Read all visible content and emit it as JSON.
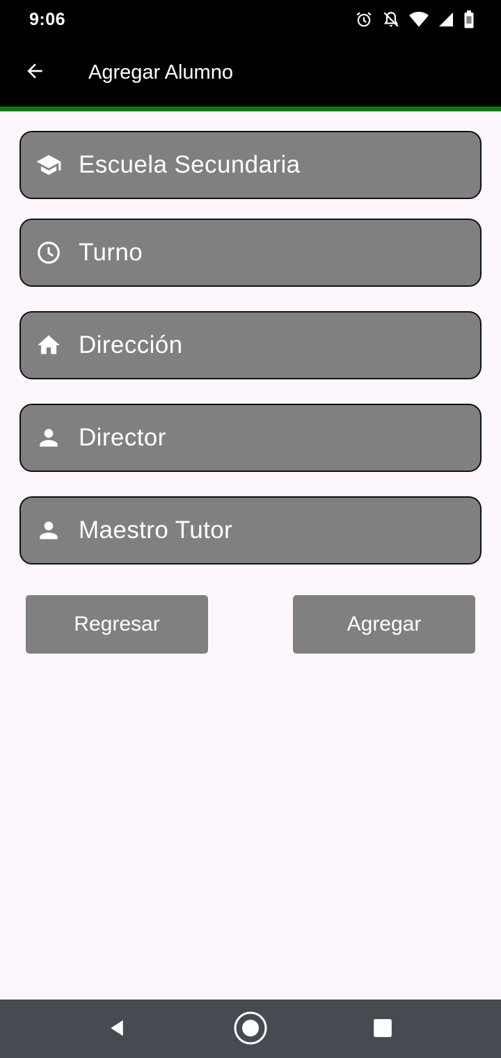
{
  "status_bar": {
    "time": "9:06",
    "icons": [
      "alarm-icon",
      "notifications-off-icon",
      "wifi-icon",
      "signal-icon",
      "battery-icon"
    ]
  },
  "app_bar": {
    "title": "Agregar Alumno",
    "back_icon": "arrow-back-icon"
  },
  "colors": {
    "app_bar": "#000000",
    "accent_line": "#0e7a0d",
    "field_bg": "#808080",
    "page_bg": "#fdf6fd",
    "nav_bar": "#464b51"
  },
  "form": {
    "fields": [
      {
        "label": "Escuela Secundaria",
        "icon": "school-icon"
      },
      {
        "label": "Turno",
        "icon": "clock-icon"
      },
      {
        "label": "Dirección",
        "icon": "home-icon"
      },
      {
        "label": "Director",
        "icon": "person-icon"
      },
      {
        "label": "Maestro Tutor",
        "icon": "person-icon"
      }
    ]
  },
  "buttons": {
    "back_label": "Regresar",
    "add_label": "Agregar"
  },
  "nav_bar": {
    "icons": [
      "nav-back-icon",
      "nav-home-icon",
      "nav-recents-icon"
    ]
  }
}
